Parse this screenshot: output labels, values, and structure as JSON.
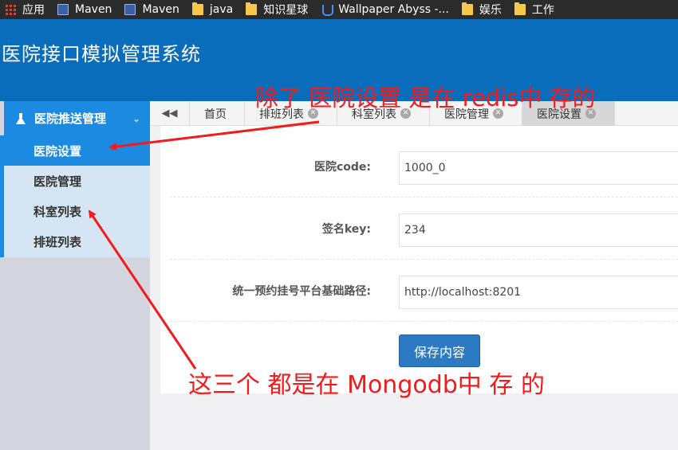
{
  "bookmarks": [
    {
      "icon": "apps-icon",
      "label": "应用"
    },
    {
      "icon": "maven-icon",
      "label": "Maven"
    },
    {
      "icon": "maven-icon",
      "label": "Maven"
    },
    {
      "icon": "folder-icon",
      "label": "java"
    },
    {
      "icon": "folder-icon",
      "label": "知识星球"
    },
    {
      "icon": "wallpaper-abyss-icon",
      "label": "Wallpaper Abyss -..."
    },
    {
      "icon": "folder-icon",
      "label": "娱乐"
    },
    {
      "icon": "folder-icon",
      "label": "工作"
    }
  ],
  "app": {
    "title": "医院接口模拟管理系统"
  },
  "sidebar": {
    "menu_label": "医院推送管理",
    "menu_icon": "flask-icon",
    "items": [
      {
        "label": "医院设置",
        "active": true
      },
      {
        "label": "医院管理"
      },
      {
        "label": "科室列表"
      },
      {
        "label": "排班列表"
      }
    ]
  },
  "tabs": [
    {
      "label": "首页"
    },
    {
      "label": "排班列表"
    },
    {
      "label": "科室列表"
    },
    {
      "label": "医院管理"
    },
    {
      "label": "医院设置",
      "active": true
    }
  ],
  "form": {
    "hoscode_label": "医院code:",
    "hoscode_value": "1000_0",
    "signkey_label": "签名key:",
    "signkey_value": "234",
    "apiurl_label": "统一预约挂号平台基础路径:",
    "apiurl_value": "http://localhost:8201",
    "save_label": "保存内容"
  },
  "annotations": {
    "top": "除了 医院设置 是在 redis中 存的",
    "bottom": "这三个 都是在 Mongodb中 存 的"
  },
  "colors": {
    "header": "#0a6dbb",
    "accent": "#1d8ae2",
    "annotation": "#f21a1a",
    "button": "#2c7bc2"
  }
}
